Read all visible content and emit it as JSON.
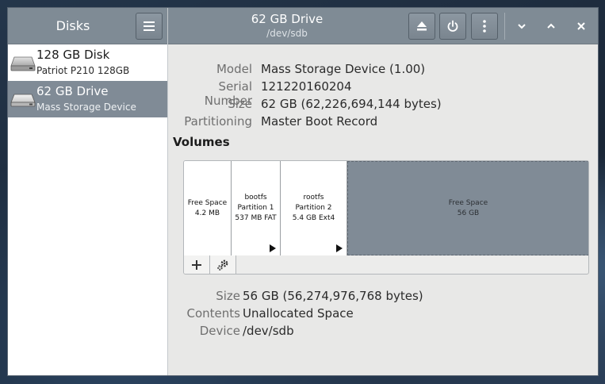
{
  "sidebar": {
    "title": "Disks",
    "menu_icon": "hamburger-menu-icon",
    "disks": [
      {
        "name": "128 GB Disk",
        "subtitle": "Patriot P210 128GB",
        "icon": "hard-disk-icon",
        "selected": false
      },
      {
        "name": "62 GB Drive",
        "subtitle": "Mass Storage Device",
        "icon": "usb-drive-icon",
        "selected": true
      }
    ]
  },
  "header": {
    "title": "62 GB Drive",
    "subtitle": "/dev/sdb",
    "actions": [
      {
        "icon": "eject-icon"
      },
      {
        "icon": "power-icon"
      },
      {
        "icon": "more-vertical-icon"
      }
    ],
    "window_controls": [
      {
        "icon": "minimize-chevron-down-icon"
      },
      {
        "icon": "maximize-chevron-up-icon"
      },
      {
        "icon": "close-icon"
      }
    ]
  },
  "drive_info": [
    {
      "label": "Model",
      "value": "Mass Storage Device (1.00)"
    },
    {
      "label": "Serial Number",
      "value": "121220160204"
    },
    {
      "label": "Size",
      "value": "62 GB (62,226,694,144 bytes)"
    },
    {
      "label": "Partitioning",
      "value": "Master Boot Record"
    }
  ],
  "volumes": {
    "heading": "Volumes",
    "items": [
      {
        "line1": "Free Space",
        "line2": "4.2 MB",
        "line3": "",
        "has_arrow": false,
        "selected": false
      },
      {
        "line1": "bootfs",
        "line2": "Partition 1",
        "line3": "537 MB FAT",
        "has_arrow": true,
        "selected": false
      },
      {
        "line1": "rootfs",
        "line2": "Partition 2",
        "line3": "5.4 GB Ext4",
        "has_arrow": true,
        "selected": false
      },
      {
        "line1": "Free Space",
        "line2": "56 GB",
        "line3": "",
        "has_arrow": false,
        "selected": true
      }
    ],
    "tools": [
      {
        "icon": "add-icon"
      },
      {
        "icon": "gears-icon"
      }
    ]
  },
  "selected_volume": [
    {
      "label": "Size",
      "value": "56 GB (56,274,976,768 bytes)"
    },
    {
      "label": "Contents",
      "value": "Unallocated Space"
    },
    {
      "label": "Device",
      "value": "/dev/sdb"
    }
  ]
}
